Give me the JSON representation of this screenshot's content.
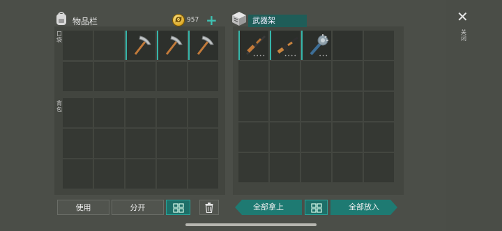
{
  "inventory": {
    "title": "物品栏",
    "coins": "957",
    "plus": "+",
    "pocket_label": "口袋",
    "backpack_label": "背包",
    "pocket_items": [
      "",
      "",
      "pickaxe-icon",
      "pickaxe-icon",
      "pickaxe-icon"
    ],
    "rows": 5,
    "cols": 5
  },
  "rack": {
    "title": "武器架",
    "items": [
      "shotgun-icon",
      "rifle-icon",
      "mace-icon"
    ],
    "rows": 5,
    "cols": 5
  },
  "buttons": {
    "use": "使用",
    "split": "分开",
    "take_all": "全部拿上",
    "put_all": "全部放入"
  },
  "close": {
    "label": "关闭"
  },
  "colors": {
    "accent": "#2aa39a",
    "bg": "#4b4e48"
  }
}
